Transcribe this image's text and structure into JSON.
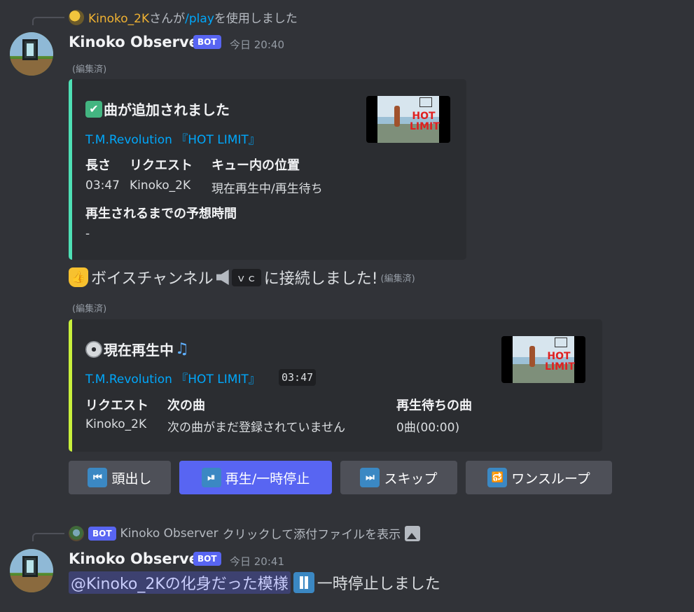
{
  "message1": {
    "reply": {
      "user": "Kinoko_2K",
      "middle": "さんが",
      "command": "/play",
      "suffix": "を使用しました"
    },
    "username": "Kinoko Observer",
    "bot_tag": "BOT",
    "timestamp": "今日 20:40",
    "edited": "(編集済)",
    "embed1": {
      "accent": "#4ee0b5",
      "title": "曲が追加されました",
      "title_emoji": "✔",
      "link": "T.M.Revolution 『HOT LIMIT』",
      "fields": [
        {
          "name": "長さ",
          "value": "03:47"
        },
        {
          "name": "リクエスト",
          "value": "Kinoko_2K"
        },
        {
          "name": "キュー内の位置",
          "value": "現在再生中/再生待ち"
        }
      ],
      "eta_name": "再生されるまでの予想時間",
      "eta_value": "-",
      "thumb_text": "HOT LIMIT"
    },
    "voice_line": {
      "text": "ボイスチャンネル",
      "channel": "ｖｃ",
      "suffix": "に接続しました!",
      "edited": "(編集済)",
      "thumbs_emoji": "👍"
    },
    "edited2": "(編集済)",
    "embed2": {
      "accent": "#c8f03c",
      "title": "現在再生中",
      "link": "T.M.Revolution 『HOT LIMIT』",
      "duration": "03:47",
      "fields": [
        {
          "name": "リクエスト",
          "value": "Kinoko_2K"
        },
        {
          "name": "次の曲",
          "value": "次の曲がまだ登録されていません"
        },
        {
          "name": "再生待ちの曲",
          "value": "0曲(00:00)"
        }
      ],
      "thumb_text": "HOT LIMIT"
    },
    "buttons": [
      {
        "label": "頭出し",
        "icon": "⏮"
      },
      {
        "label": "再生/一時停止",
        "icon": "⏯"
      },
      {
        "label": "スキップ",
        "icon": "⏭"
      },
      {
        "label": "ワンスループ",
        "icon": "🔂"
      }
    ]
  },
  "message2": {
    "reply": {
      "bot_tag": "BOT",
      "user": "Kinoko Observer",
      "text": "クリックして添付ファイルを表示"
    },
    "username": "Kinoko Observer",
    "bot_tag": "BOT",
    "timestamp": "今日 20:41",
    "mention": "@Kinoko_2Kの化身だった模様",
    "text": "一時停止しました"
  },
  "colors": {
    "background": "#313338",
    "embed_bg": "#2b2d31",
    "link": "#00a8fc",
    "blurple": "#5865f2"
  }
}
